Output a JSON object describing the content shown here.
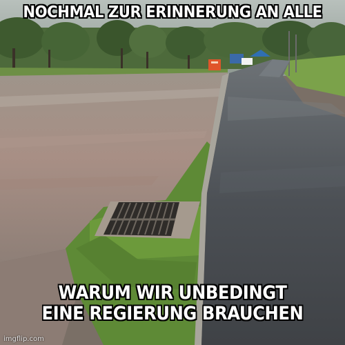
{
  "meme": {
    "top_text": "NOCHMAL ZUR ERINNERUNG AN ALLE",
    "bottom_lines": [
      "WARUM WIR UNBEDINGT",
      "EINE REGIERUNG BRAUCHEN"
    ],
    "watermark": "imgflip.com"
  },
  "colors": {
    "sky": "#a9b4b0",
    "trees": "#3f5a32",
    "lawn": "#6f9a3e",
    "flood_water": "#a58f84",
    "road": "#4b4e52",
    "curb": "#a8a59c",
    "grate": "#2f2c29"
  }
}
